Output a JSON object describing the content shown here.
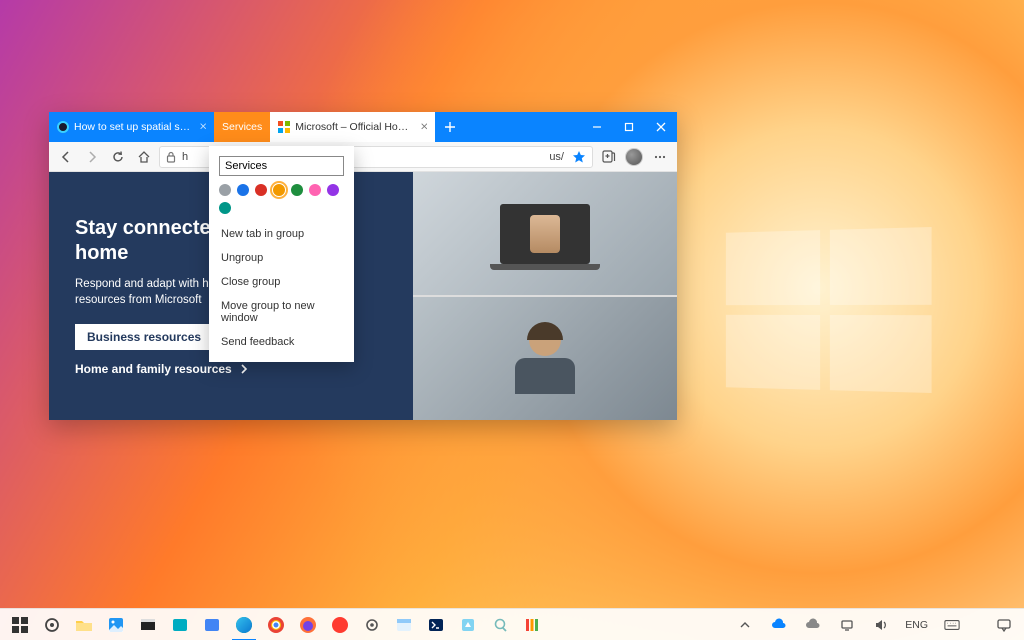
{
  "tabs": [
    {
      "label": "How to set up spatial sound with"
    },
    {
      "label": "Services"
    },
    {
      "label": "Microsoft – Official Home Page"
    }
  ],
  "addr": {
    "url_left": "h",
    "url_right": "us/"
  },
  "ctx": {
    "input": "Services",
    "items": {
      "newtab": "New tab in group",
      "ungroup": "Ungroup",
      "close": "Close group",
      "movewin": "Move group to new window",
      "feedback": "Send feedback"
    },
    "colors": [
      "#9aa0a6",
      "#1a73e8",
      "#d93025",
      "#f29900",
      "#1e8e3e",
      "#ff63b1",
      "#9334e6",
      "#009688"
    ]
  },
  "hero": {
    "title_a": "Stay connected at",
    "title_b": "home",
    "body": "Respond and adapt with hel",
    "body2": "resources from Microsoft",
    "btn": "Business resources",
    "link": "Home and family resources"
  },
  "tray": {
    "lang": "ENG",
    "time": "",
    "date": ""
  }
}
